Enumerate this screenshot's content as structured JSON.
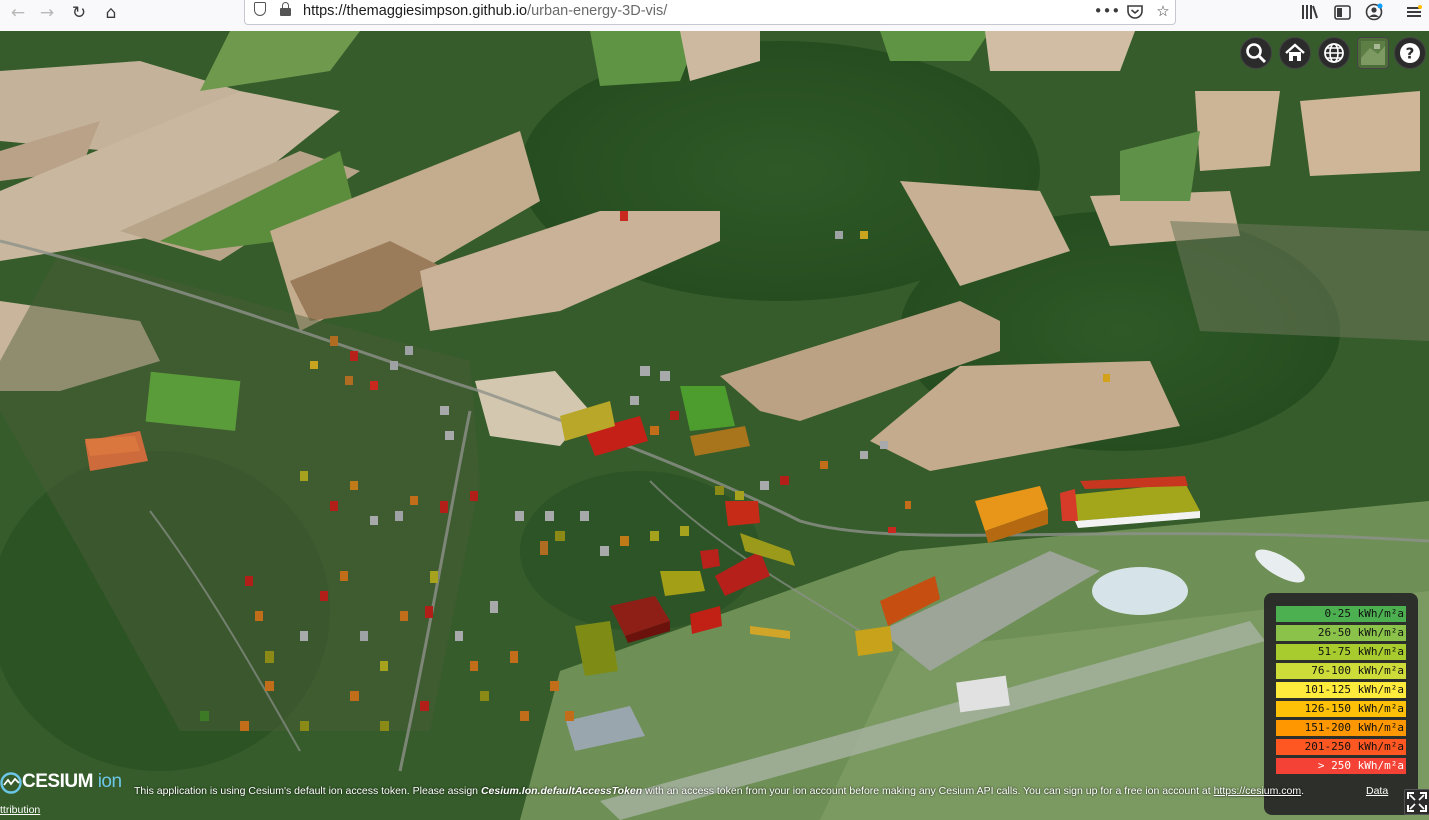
{
  "browser": {
    "url_host": "https://themaggiesimpson.github.io",
    "url_path": "/urban-energy-3D-vis/",
    "icons": [
      "back-icon",
      "forward-icon",
      "reload-icon",
      "home-icon",
      "shield-icon",
      "lock-icon",
      "more-icon",
      "pocket-icon",
      "bookmark-star-icon",
      "library-icon",
      "sidebar-icon",
      "account-icon",
      "menu-icon"
    ]
  },
  "toolbar": {
    "icons": [
      "search-icon",
      "home-icon",
      "globe-icon",
      "layers-icon",
      "help-icon"
    ]
  },
  "legend": {
    "items": [
      {
        "label": "0-25 kWh/m²a",
        "color": "#4caf50"
      },
      {
        "label": "26-50 kWh/m²a",
        "color": "#8bc34a"
      },
      {
        "label": "51-75 kWh/m²a",
        "color": "#a8cc2e"
      },
      {
        "label": "76-100 kWh/m²a",
        "color": "#cddc39"
      },
      {
        "label": "101-125 kWh/m²a",
        "color": "#ffeb3b"
      },
      {
        "label": "126-150 kWh/m²a",
        "color": "#ffc107"
      },
      {
        "label": "151-200 kWh/m²a",
        "color": "#ff9800"
      },
      {
        "label": "201-250 kWh/m²a",
        "color": "#ff5722"
      },
      {
        "label": "> 250 kWh/m²a",
        "color": "#f44336"
      }
    ]
  },
  "credits": {
    "logo_main": "CESIUM",
    "logo_sub": "ion",
    "msg_prefix": "This application is using Cesium's default ion access token. Please assign ",
    "msg_token": "Cesium.Ion.defaultAccessToken",
    "msg_suffix": " with an access token from your ion account before making any Cesium API calls. You can sign up for a free ion account at ",
    "msg_link": "https://cesium.com",
    "msg_end": ".",
    "data_attribution": "Data",
    "attribution_tail": "ttribution"
  }
}
